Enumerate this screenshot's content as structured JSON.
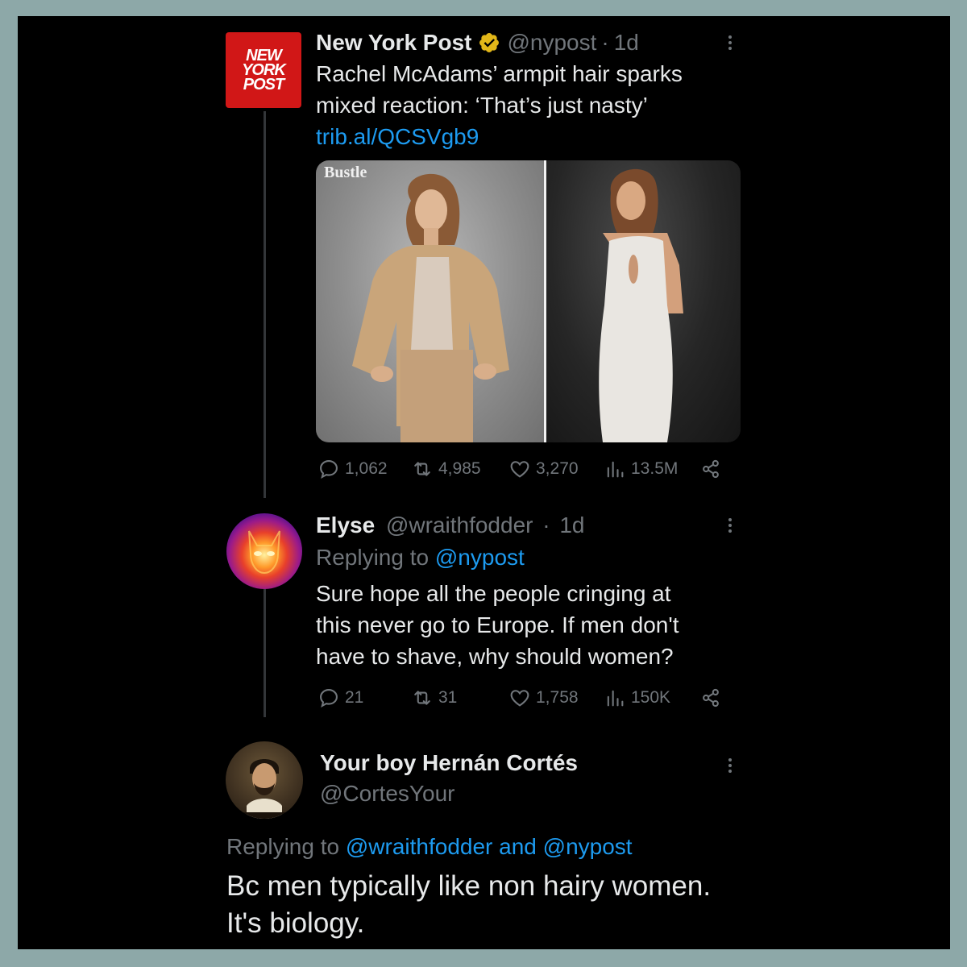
{
  "tweet1": {
    "name": "New York Post",
    "handle": "@nypost",
    "sep": "·",
    "time": "1d",
    "text_line1": "Rachel McAdams’ armpit hair sparks",
    "text_line2": "mixed reaction: ‘That’s just nasty’",
    "link": "trib.al/QCSVgb9",
    "logo_lines": [
      "NEW",
      "YORK",
      "POST"
    ],
    "media_watermark": "Bustle",
    "stats": {
      "replies": "1,062",
      "reposts": "4,985",
      "likes": "3,270",
      "views": "13.5M"
    }
  },
  "tweet2": {
    "name": "Elyse",
    "handle": "@wraithfodder",
    "sep": "·",
    "time": "1d",
    "replying_prefix": "Replying to",
    "replying_to": "@nypost",
    "text_line1": "Sure hope all the people cringing at",
    "text_line2": "this never go to Europe. If men don't",
    "text_line3": "have to shave, why should women?",
    "stats": {
      "replies": "21",
      "reposts": "31",
      "likes": "1,758",
      "views": "150K"
    }
  },
  "tweet3": {
    "name": "Your boy Hernán Cortés",
    "handle": "@CortesYour",
    "replying_prefix": "Replying to",
    "replying_to": "@wraithfodder and @nypost",
    "text_line1": "Bc men typically like non hairy women.",
    "text_line2": "It's biology."
  },
  "icons": {
    "verified": "verified-badge-icon",
    "reply": "reply-icon",
    "repost": "repost-icon",
    "like": "heart-icon",
    "views": "views-icon",
    "share": "share-icon",
    "more": "more-icon"
  },
  "colors": {
    "background": "#000000",
    "frame": "#8da8a8",
    "link": "#1d9bf0",
    "muted": "#71767b",
    "verified": "#e2b719",
    "nypost_red": "#d11717"
  }
}
